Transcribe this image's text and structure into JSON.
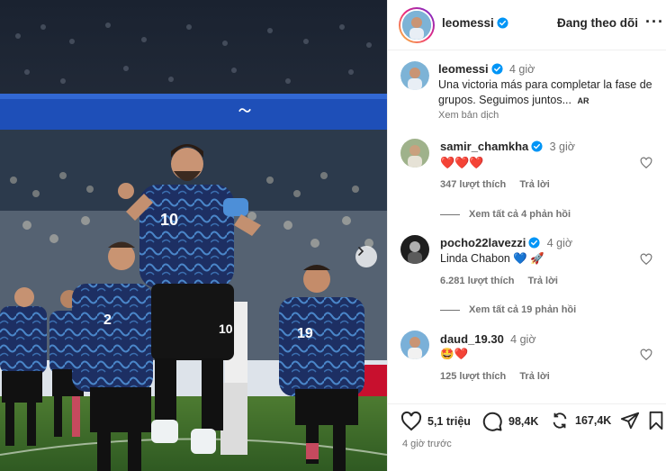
{
  "header": {
    "username": "leomessi",
    "follow_label": "Đang theo dõi",
    "more_icon": "more-horizontal-icon"
  },
  "caption": {
    "username": "leomessi",
    "time": "4 giờ",
    "text": "Una victoria más para completar la fase de grupos. Seguimos juntos...",
    "flag": "AR",
    "translate": "Xem bản dịch"
  },
  "comments": [
    {
      "username": "samir_chamkha",
      "verified": true,
      "time": "3 giờ",
      "text": "❤️❤️❤️",
      "likes": "347 lượt thích",
      "reply": "Trả lời",
      "view_replies": "Xem tất cả 4 phản hồi"
    },
    {
      "username": "pocho22lavezzi",
      "verified": true,
      "time": "4 giờ",
      "text": "Linda Chabon 💙 🚀",
      "likes": "6.281 lượt thích",
      "reply": "Trả lời",
      "view_replies": "Xem tất cả 19 phản hồi"
    },
    {
      "username": "daud_19.30",
      "verified": false,
      "time": "4 giờ",
      "text": "🤩❤️",
      "likes": "125 lượt thích",
      "reply": "Trả lời"
    }
  ],
  "actions": {
    "likes": "5,1 triệu",
    "comments": "98,4K",
    "reposts": "167,4K"
  },
  "post_time": "4 giờ trước",
  "colors": {
    "verified_blue": "#0095f6",
    "muted_text": "#737373",
    "jersey_blue": "#1c2d5e",
    "pitch_green": "#3f6b2a"
  }
}
